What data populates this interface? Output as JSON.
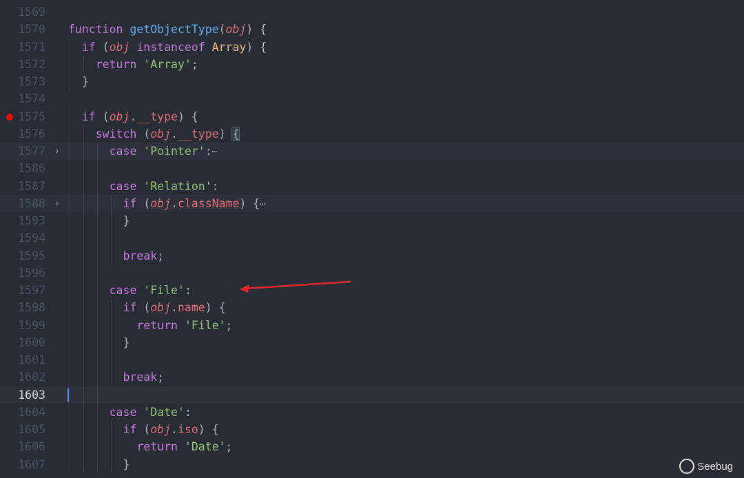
{
  "editor": {
    "lines": [
      {
        "num": "1569",
        "tokens": []
      },
      {
        "num": "1570",
        "tokens": [
          {
            "c": "kw",
            "t": "function"
          },
          {
            "c": "pun",
            "t": " "
          },
          {
            "c": "fn",
            "t": "getObjectType"
          },
          {
            "c": "pun",
            "t": "("
          },
          {
            "c": "param",
            "t": "obj"
          },
          {
            "c": "pun",
            "t": ") {"
          }
        ]
      },
      {
        "num": "1571",
        "tokens": [
          {
            "c": "pun",
            "t": "  "
          },
          {
            "c": "kw",
            "t": "if"
          },
          {
            "c": "pun",
            "t": " ("
          },
          {
            "c": "param",
            "t": "obj"
          },
          {
            "c": "pun",
            "t": " "
          },
          {
            "c": "kw",
            "t": "instanceof"
          },
          {
            "c": "pun",
            "t": " "
          },
          {
            "c": "cls",
            "t": "Array"
          },
          {
            "c": "pun",
            "t": ") {"
          }
        ]
      },
      {
        "num": "1572",
        "tokens": [
          {
            "c": "pun",
            "t": "    "
          },
          {
            "c": "kw",
            "t": "return"
          },
          {
            "c": "pun",
            "t": " "
          },
          {
            "c": "str",
            "t": "'Array'"
          },
          {
            "c": "pun",
            "t": ";"
          }
        ]
      },
      {
        "num": "1573",
        "tokens": [
          {
            "c": "pun",
            "t": "  }"
          }
        ]
      },
      {
        "num": "1574",
        "tokens": []
      },
      {
        "num": "1575",
        "breakpoint": true,
        "tokens": [
          {
            "c": "pun",
            "t": "  "
          },
          {
            "c": "kw",
            "t": "if"
          },
          {
            "c": "pun",
            "t": " ("
          },
          {
            "c": "param",
            "t": "obj"
          },
          {
            "c": "pun",
            "t": "."
          },
          {
            "c": "prop",
            "t": "__type"
          },
          {
            "c": "pun",
            "t": ") {"
          }
        ]
      },
      {
        "num": "1576",
        "tokens": [
          {
            "c": "pun",
            "t": "    "
          },
          {
            "c": "kw",
            "t": "switch"
          },
          {
            "c": "pun",
            "t": " ("
          },
          {
            "c": "param",
            "t": "obj"
          },
          {
            "c": "pun",
            "t": "."
          },
          {
            "c": "prop",
            "t": "__type"
          },
          {
            "c": "pun",
            "t": ") "
          },
          {
            "c": "pun bracket-hl",
            "t": "{"
          }
        ]
      },
      {
        "num": "1577",
        "fold": true,
        "tokens": [
          {
            "c": "pun",
            "t": "      "
          },
          {
            "c": "kw",
            "t": "case"
          },
          {
            "c": "pun",
            "t": " "
          },
          {
            "c": "str",
            "t": "'Pointer'"
          },
          {
            "c": "pun",
            "t": ":"
          },
          {
            "c": "ell",
            "t": "⋯"
          }
        ]
      },
      {
        "num": "1586",
        "tokens": []
      },
      {
        "num": "1587",
        "tokens": [
          {
            "c": "pun",
            "t": "      "
          },
          {
            "c": "kw",
            "t": "case"
          },
          {
            "c": "pun",
            "t": " "
          },
          {
            "c": "str",
            "t": "'Relation'"
          },
          {
            "c": "pun",
            "t": ":"
          }
        ]
      },
      {
        "num": "1588",
        "fold": true,
        "tokens": [
          {
            "c": "pun",
            "t": "        "
          },
          {
            "c": "kw",
            "t": "if"
          },
          {
            "c": "pun",
            "t": " ("
          },
          {
            "c": "param",
            "t": "obj"
          },
          {
            "c": "pun",
            "t": "."
          },
          {
            "c": "prop",
            "t": "className"
          },
          {
            "c": "pun",
            "t": ") {"
          },
          {
            "c": "ell",
            "t": "⋯"
          }
        ]
      },
      {
        "num": "1593",
        "tokens": [
          {
            "c": "pun",
            "t": "        }"
          }
        ]
      },
      {
        "num": "1594",
        "tokens": []
      },
      {
        "num": "1595",
        "tokens": [
          {
            "c": "pun",
            "t": "        "
          },
          {
            "c": "kw",
            "t": "break"
          },
          {
            "c": "pun",
            "t": ";"
          }
        ]
      },
      {
        "num": "1596",
        "tokens": []
      },
      {
        "num": "1597",
        "tokens": [
          {
            "c": "pun",
            "t": "      "
          },
          {
            "c": "kw",
            "t": "case"
          },
          {
            "c": "pun",
            "t": " "
          },
          {
            "c": "str",
            "t": "'File'"
          },
          {
            "c": "pun",
            "t": ":"
          }
        ]
      },
      {
        "num": "1598",
        "tokens": [
          {
            "c": "pun",
            "t": "        "
          },
          {
            "c": "kw",
            "t": "if"
          },
          {
            "c": "pun",
            "t": " ("
          },
          {
            "c": "param",
            "t": "obj"
          },
          {
            "c": "pun",
            "t": "."
          },
          {
            "c": "prop",
            "t": "name"
          },
          {
            "c": "pun",
            "t": ") {"
          }
        ]
      },
      {
        "num": "1599",
        "tokens": [
          {
            "c": "pun",
            "t": "          "
          },
          {
            "c": "kw",
            "t": "return"
          },
          {
            "c": "pun",
            "t": " "
          },
          {
            "c": "str",
            "t": "'File'"
          },
          {
            "c": "pun",
            "t": ";"
          }
        ]
      },
      {
        "num": "1600",
        "tokens": [
          {
            "c": "pun",
            "t": "        }"
          }
        ]
      },
      {
        "num": "1601",
        "tokens": []
      },
      {
        "num": "1602",
        "tokens": [
          {
            "c": "pun",
            "t": "        "
          },
          {
            "c": "kw",
            "t": "break"
          },
          {
            "c": "pun",
            "t": ";"
          }
        ]
      },
      {
        "num": "1603",
        "current": true,
        "tokens": []
      },
      {
        "num": "1604",
        "tokens": [
          {
            "c": "pun",
            "t": "      "
          },
          {
            "c": "kw",
            "t": "case"
          },
          {
            "c": "pun",
            "t": " "
          },
          {
            "c": "str",
            "t": "'Date'"
          },
          {
            "c": "pun",
            "t": ":"
          }
        ]
      },
      {
        "num": "1605",
        "tokens": [
          {
            "c": "pun",
            "t": "        "
          },
          {
            "c": "kw",
            "t": "if"
          },
          {
            "c": "pun",
            "t": " ("
          },
          {
            "c": "param",
            "t": "obj"
          },
          {
            "c": "pun",
            "t": "."
          },
          {
            "c": "prop",
            "t": "iso"
          },
          {
            "c": "pun",
            "t": ") {"
          }
        ]
      },
      {
        "num": "1606",
        "tokens": [
          {
            "c": "pun",
            "t": "          "
          },
          {
            "c": "kw",
            "t": "return"
          },
          {
            "c": "pun",
            "t": " "
          },
          {
            "c": "str",
            "t": "'Date'"
          },
          {
            "c": "pun",
            "t": ";"
          }
        ]
      },
      {
        "num": "1607",
        "tokens": [
          {
            "c": "pun",
            "t": "        }"
          }
        ]
      }
    ]
  },
  "annotation": {
    "arrow_color": "#e0282e",
    "arrow_target_line": "1597"
  },
  "watermark": {
    "text": "Seebug"
  },
  "colors": {
    "background": "#282c34",
    "keyword": "#c678dd",
    "function": "#61afef",
    "variable": "#e06c75",
    "class": "#e5c07b",
    "string": "#98c379"
  }
}
